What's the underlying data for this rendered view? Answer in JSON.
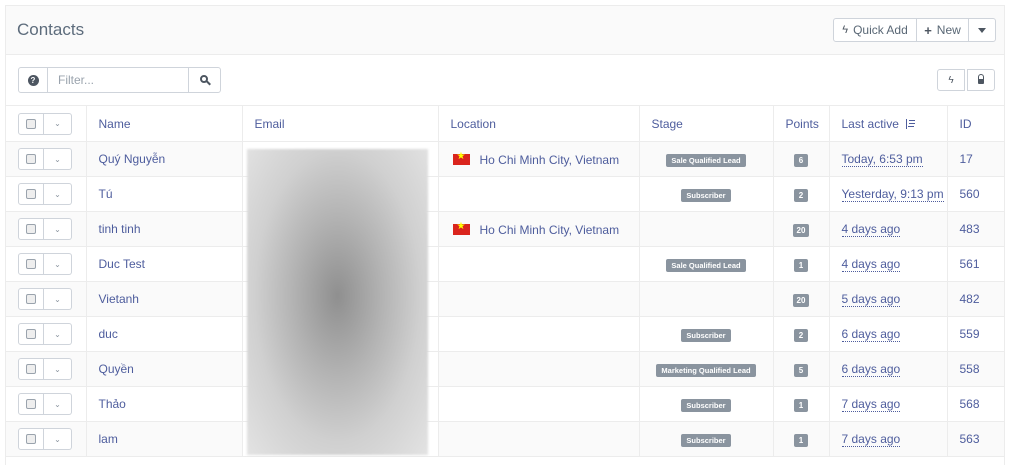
{
  "header": {
    "title": "Contacts",
    "quick_add_label": "Quick Add",
    "new_label": "New"
  },
  "filter": {
    "placeholder": "Filter..."
  },
  "columns": {
    "name": "Name",
    "email": "Email",
    "location": "Location",
    "stage": "Stage",
    "points": "Points",
    "last_active": "Last active",
    "id": "ID"
  },
  "rows": [
    {
      "name": "Quý Nguyễn",
      "location": "Ho Chi Minh City, Vietnam",
      "has_flag": true,
      "stage": "Sale Qualified Lead",
      "points": "6",
      "last_active": "Today, 6:53 pm",
      "id": "17"
    },
    {
      "name": "Tú",
      "location": "",
      "has_flag": false,
      "stage": "Subscriber",
      "points": "2",
      "last_active": "Yesterday, 9:13 pm",
      "id": "560"
    },
    {
      "name": "tinh tinh",
      "location": "Ho Chi Minh City, Vietnam",
      "has_flag": true,
      "stage": "",
      "points": "20",
      "last_active": "4 days ago",
      "id": "483"
    },
    {
      "name": "Duc Test",
      "location": "",
      "has_flag": false,
      "stage": "Sale Qualified Lead",
      "points": "1",
      "last_active": "4 days ago",
      "id": "561"
    },
    {
      "name": "Vietanh",
      "location": "",
      "has_flag": false,
      "stage": "",
      "points": "20",
      "last_active": "5 days ago",
      "id": "482"
    },
    {
      "name": "duc",
      "location": "",
      "has_flag": false,
      "stage": "Subscriber",
      "points": "2",
      "last_active": "6 days ago",
      "id": "559"
    },
    {
      "name": "Quyền",
      "location": "",
      "has_flag": false,
      "stage": "Marketing Qualified Lead",
      "points": "5",
      "last_active": "6 days ago",
      "id": "558"
    },
    {
      "name": "Thảo",
      "location": "",
      "has_flag": false,
      "stage": "Subscriber",
      "points": "1",
      "last_active": "7 days ago",
      "id": "568"
    },
    {
      "name": "lam",
      "location": "",
      "has_flag": false,
      "stage": "Subscriber",
      "points": "1",
      "last_active": "7 days ago",
      "id": "563"
    }
  ],
  "colors": {
    "link": "#4e5d9d",
    "badge": "#8a949f",
    "border": "#ececec",
    "flag_red": "#da251d",
    "flag_star": "#ffff00"
  }
}
